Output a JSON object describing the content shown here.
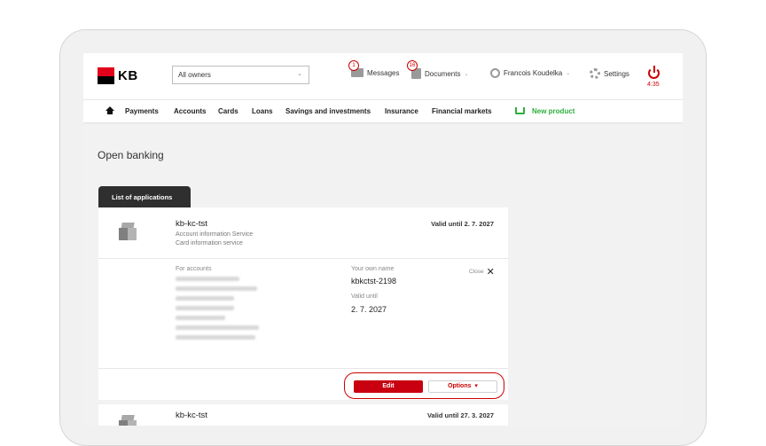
{
  "header": {
    "brand": "KB",
    "owners_select": "All owners",
    "messages": {
      "count": "1",
      "label": "Messages"
    },
    "documents": {
      "count": "16",
      "label": "Documents"
    },
    "user": "Francois Koudelka",
    "settings": "Settings",
    "session_timer": "4:35"
  },
  "nav": {
    "items": [
      "Payments",
      "Accounts",
      "Cards",
      "Loans",
      "Savings and investments",
      "Insurance",
      "Financial markets"
    ],
    "new_product": "New product"
  },
  "page": {
    "title": "Open banking",
    "tab": "List of applications"
  },
  "application": {
    "name": "kb-kc-tst",
    "services": [
      "Account information Service",
      "Card information service"
    ],
    "valid_until_header": "Valid until 2. 7. 2027",
    "for_accounts_label": "For accounts",
    "own_name_label": "Your own name",
    "own_name_value": "kbkctst-2198",
    "valid_until_label": "Valid until",
    "valid_until_value": "2. 7. 2027",
    "close_label": "Close",
    "edit_button": "Edit",
    "options_button": "Options"
  },
  "application2": {
    "name": "kb-kc-tst",
    "valid_until_header": "Valid until 27. 3. 2027"
  },
  "colors": {
    "brand_red": "#e2001a",
    "accent_green": "#2eae3d",
    "button_red": "#c8000f"
  }
}
